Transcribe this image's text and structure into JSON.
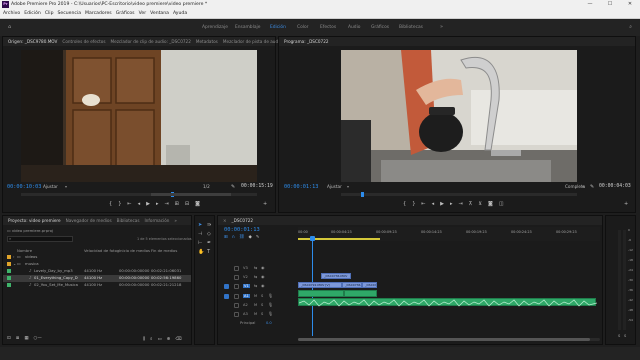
{
  "window": {
    "title": "Adobe Premiere Pro 2019 - C:\\Usuarios\\PC-Escritorio\\video premiere\\video premiere *",
    "app_badge": "Pr",
    "controls": [
      "—",
      "☐",
      "✕"
    ]
  },
  "menu": [
    "Archivo",
    "Edición",
    "Clip",
    "Secuencia",
    "Marcadores",
    "Gráficos",
    "Ver",
    "Ventana",
    "Ayuda"
  ],
  "workspaces": {
    "items": [
      "Aprendizaje",
      "Ensamblaje",
      "Edición",
      "Color",
      "Efectos",
      "Audio",
      "Gráficos",
      "Bibliotecas"
    ],
    "active": "Edición"
  },
  "source_monitor": {
    "tabs": [
      "Origen: _DSC9780.MOV",
      "Controles de efectos",
      "Mezclador de clip de audio: _DSC0722",
      "Metadatos",
      "Mezclador de pista de audio: _DSC0722"
    ],
    "timecode": "00:00:10:03",
    "fit": "Ajustar",
    "page": "1/2",
    "duration": "00:00:15:19"
  },
  "program_monitor": {
    "tabs": [
      "Programa: _DSC0722"
    ],
    "timecode": "00:00:01:13",
    "fit": "Ajustar",
    "quality": "Completa",
    "duration": "00:00:04:03"
  },
  "project_panel": {
    "tabs": [
      "Proyecto: video premiere",
      "Navegador de medios",
      "Bibliotecas",
      "Información"
    ],
    "project_file": "video premiere.prproj",
    "selection_info": "1 de 5 elementos seleccionados",
    "columns": [
      "Nombre",
      "Velocidad de fotog",
      "Inicio de medios",
      "Fin de medios"
    ],
    "rows": [
      {
        "name": "videos",
        "kind": "bin",
        "fps": "",
        "start": "",
        "end": "",
        "color": "#e0a42a"
      },
      {
        "name": "musica",
        "kind": "bin",
        "fps": "",
        "start": "",
        "end": "",
        "color": "#e0a42a"
      },
      {
        "name": "Lovely_Day_by_mp3",
        "kind": "audio",
        "fps": "44100 Hz",
        "start": "00:00:00:00000",
        "end": "00:02:21:06031",
        "color": "#3fb36a"
      },
      {
        "name": "01_Everything_Copy_D",
        "kind": "audio",
        "fps": "44100 Hz",
        "start": "00:00:00:00000",
        "end": "00:02:56:19860",
        "color": "#3fb36a"
      },
      {
        "name": "02_You_Set_Me_Musica",
        "kind": "audio",
        "fps": "44100 Hz",
        "start": "00:00:00:00000",
        "end": "00:02:21:21218",
        "color": "#3fb36a"
      }
    ]
  },
  "timeline": {
    "tabs": [
      "_DSC0722"
    ],
    "timecode": "00:00:01:13",
    "ruler": [
      "00:00",
      "00:00:04:23",
      "00:00:09:23",
      "00:00:14:23",
      "00:00:19:23",
      "00:00:24:23",
      "00:00:29:23"
    ],
    "video_tracks": [
      "V3",
      "V2",
      "V1"
    ],
    "audio_tracks": [
      "A1",
      "A2",
      "A3"
    ],
    "master": "Principal",
    "master_value": "0.0",
    "clips": {
      "v2": "_DSC0736.MOV",
      "v1a": "_DSC0722.MOV [V]",
      "v1b": "_DSC0736.MOV [V]",
      "v1c": "_DSC0734.MOV"
    }
  },
  "audio_meter": {
    "scale": [
      "0",
      "-6",
      "-12",
      "-18",
      "-24",
      "-30",
      "-36",
      "-42",
      "-48",
      "-54"
    ],
    "bottom": [
      "S",
      "S"
    ]
  },
  "colors": {
    "accent": "#2d8ceb",
    "audio_clip": "#2fa868",
    "video_clip": "#6e8fd6",
    "bin": "#e0a42a"
  }
}
